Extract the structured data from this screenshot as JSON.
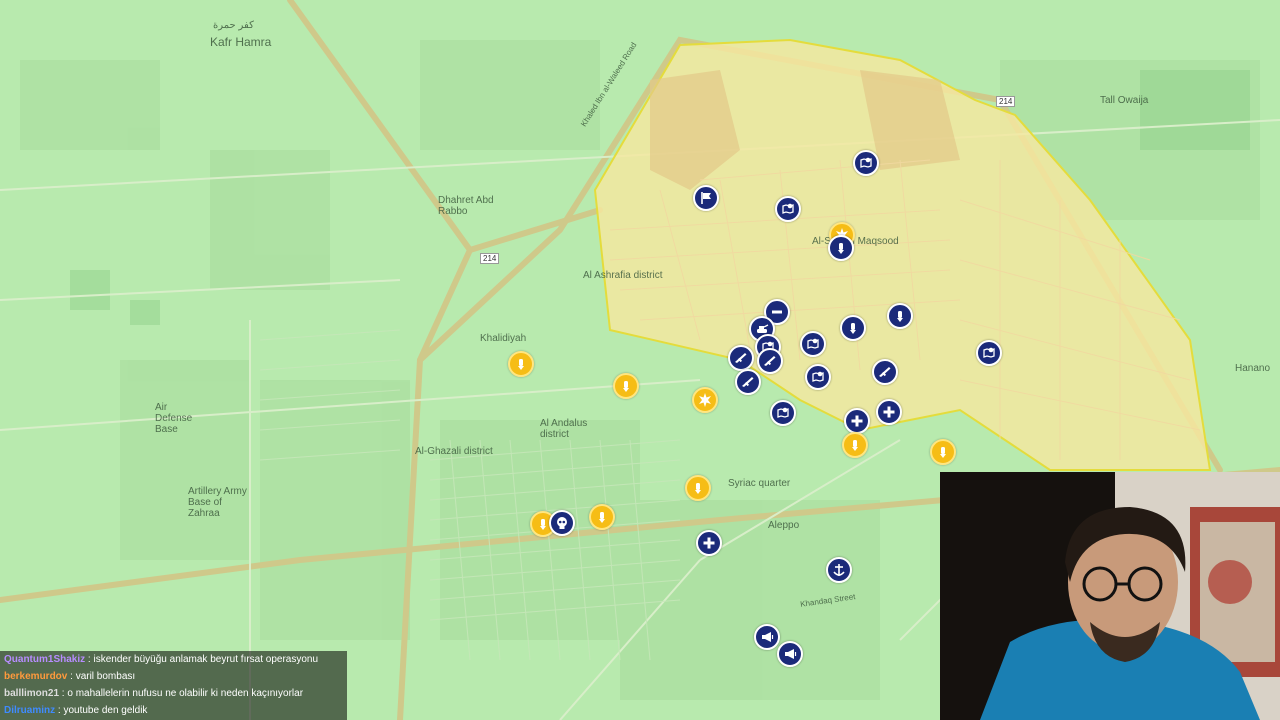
{
  "map": {
    "labels": [
      {
        "text": "كفر حمرة",
        "id": "kafr-hamra-ar"
      },
      {
        "text": "Kafr Hamra",
        "id": "kafr-hamra"
      },
      {
        "text": "Dhahret Abd Rabbo",
        "id": "dhahret"
      },
      {
        "text": "Air Defense Base",
        "id": "air-defense"
      },
      {
        "text": "Artillery Army Base of Zahraa",
        "id": "artillery"
      },
      {
        "text": "Al Andalus district",
        "id": "andalus"
      },
      {
        "text": "Al-Ghazali district",
        "id": "ghazali"
      },
      {
        "text": "Syriac quarter",
        "id": "syriac"
      },
      {
        "text": "Aleppo",
        "id": "aleppo"
      },
      {
        "text": "Tall Owaija",
        "id": "tall-owaija"
      },
      {
        "text": "Hanano",
        "id": "hanano"
      },
      {
        "text": "Al-Sheikh Maqsood",
        "id": "maqsood"
      },
      {
        "text": "Al Ashrafia district",
        "id": "ashrafia"
      },
      {
        "text": "Khalidiyah",
        "id": "khalidiyah"
      },
      {
        "text": "Khaled Ibn al-Waleed Road",
        "id": "khaled-road"
      },
      {
        "text": "214",
        "id": "road-214a"
      },
      {
        "text": "214",
        "id": "road-214b"
      },
      {
        "text": "Khandaq Street",
        "id": "khandaq"
      }
    ],
    "zone_color": "#f3e79c",
    "zone_border": "#e8de4a"
  },
  "markers": [
    {
      "type": "navy",
      "icon": "flag-icon"
    },
    {
      "type": "navy",
      "icon": "map-pin-icon"
    },
    {
      "type": "navy",
      "icon": "map-pin-icon"
    },
    {
      "type": "gold",
      "icon": "explosion-icon"
    },
    {
      "type": "navy",
      "icon": "bomb-icon"
    },
    {
      "type": "navy",
      "icon": "no-entry-icon"
    },
    {
      "type": "navy",
      "icon": "tank-icon"
    },
    {
      "type": "navy",
      "icon": "map-pin-icon"
    },
    {
      "type": "navy",
      "icon": "bomb-icon"
    },
    {
      "type": "navy",
      "icon": "bomb-icon"
    },
    {
      "type": "navy",
      "icon": "map-pin-icon"
    },
    {
      "type": "navy",
      "icon": "rifle-icon"
    },
    {
      "type": "navy",
      "icon": "rifle-icon"
    },
    {
      "type": "navy",
      "icon": "rifle-icon"
    },
    {
      "type": "navy",
      "icon": "map-pin-icon"
    },
    {
      "type": "navy",
      "icon": "rifle-icon"
    },
    {
      "type": "navy",
      "icon": "map-pin-icon"
    },
    {
      "type": "navy",
      "icon": "medical-icon"
    },
    {
      "type": "navy",
      "icon": "medical-icon"
    },
    {
      "type": "navy",
      "icon": "map-pin-icon"
    },
    {
      "type": "gold",
      "icon": "bomb-icon"
    },
    {
      "type": "gold",
      "icon": "bomb-icon"
    },
    {
      "type": "gold",
      "icon": "explosion-icon"
    },
    {
      "type": "gold",
      "icon": "bomb-icon"
    },
    {
      "type": "gold",
      "icon": "bomb-icon"
    },
    {
      "type": "gold",
      "icon": "bomb-icon"
    },
    {
      "type": "gold",
      "icon": "bomb-icon"
    },
    {
      "type": "gold",
      "icon": "bomb-icon"
    },
    {
      "type": "navy",
      "icon": "skull-icon"
    },
    {
      "type": "navy",
      "icon": "medical-icon"
    },
    {
      "type": "navy",
      "icon": "anchor-icon"
    },
    {
      "type": "navy",
      "icon": "megaphone-icon"
    },
    {
      "type": "navy",
      "icon": "megaphone-icon"
    }
  ],
  "chat": {
    "messages": [
      {
        "user": "Quantum1Shakiz",
        "user_color": "#b78cff",
        "text": " : iskender büyüğu anlamak beyrut fırsat operasyonu"
      },
      {
        "user": "berkemurdov",
        "user_color": "#ff9a3c",
        "text": " : varil bombası"
      },
      {
        "user": "balllimon21",
        "user_color": "#dddddd",
        "text": " : o mahallelerin nufusu ne olabilir ki neden kaçınıyorlar"
      },
      {
        "user": "Dilruaminz",
        "user_color": "#3f8bff",
        "text": " : youtube den geldik"
      }
    ]
  },
  "colors": {
    "navy": "#1b2a7a",
    "gold": "#f6bd16",
    "map_green": "#b9ecb0",
    "road": "#c9c27a"
  }
}
